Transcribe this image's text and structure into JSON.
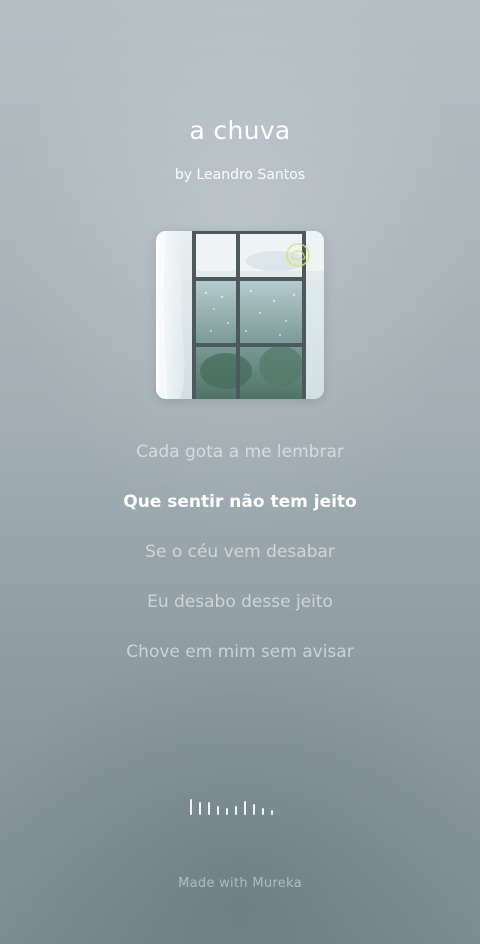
{
  "song": {
    "title": "a chuva",
    "artist": "by Leandro Santos"
  },
  "cover": {
    "description_icon": "rain-window-artwork",
    "badge_icon": "rain-cloud-icon"
  },
  "lyrics": [
    {
      "text": "Cada gota a me lembrar",
      "active": false
    },
    {
      "text": "Que sentir não tem jeito",
      "active": true
    },
    {
      "text": "Se o céu vem desabar",
      "active": false
    },
    {
      "text": "Eu desabo desse jeito",
      "active": false
    },
    {
      "text": "Chove em mim sem avisar",
      "active": false
    }
  ],
  "waveform": {
    "icon": "audio-waveform-icon",
    "levels": [
      0.9,
      0.7,
      0.7,
      0.5,
      0.4,
      0.5,
      0.8,
      0.6,
      0.4,
      0.3
    ]
  },
  "footer": {
    "text": "Made with Mureka"
  },
  "colors": {
    "text": "#ffffff",
    "background_top": "#b4bec3",
    "background_bottom": "#7c8d93"
  }
}
